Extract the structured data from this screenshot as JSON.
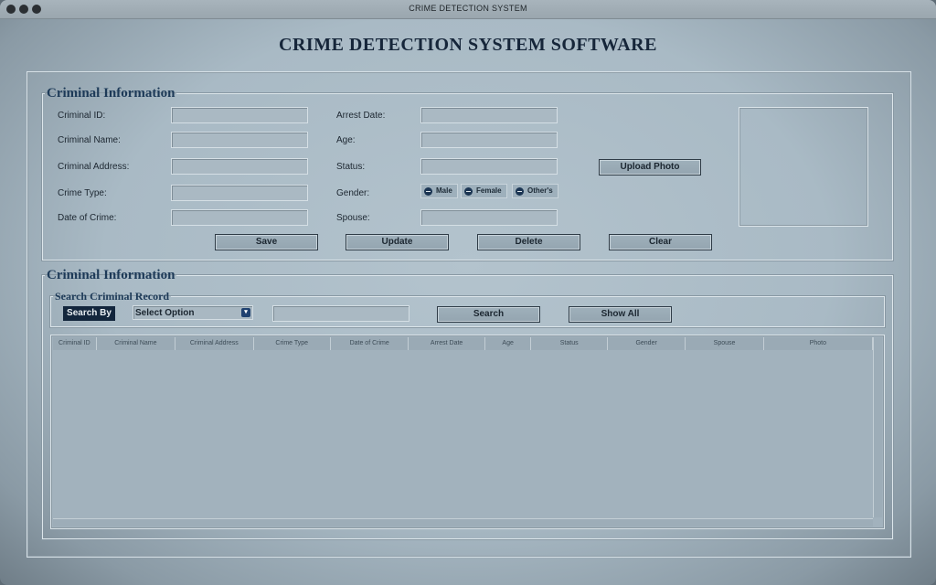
{
  "window": {
    "title": "CRIME DETECTION SYSTEM"
  },
  "app": {
    "title": "CRIME DETECTION SYSTEM SOFTWARE"
  },
  "info_section": {
    "legend": "Criminal Information",
    "left_fields": [
      {
        "label": "Criminal ID:",
        "value": ""
      },
      {
        "label": "Criminal Name:",
        "value": ""
      },
      {
        "label": "Criminal Address:",
        "value": ""
      },
      {
        "label": "Crime Type:",
        "value": ""
      },
      {
        "label": "Date of Crime:",
        "value": ""
      }
    ],
    "right_fields": [
      {
        "label": "Arrest Date:",
        "value": ""
      },
      {
        "label": "Age:",
        "value": ""
      },
      {
        "label": "Status:",
        "value": ""
      },
      {
        "label": "Gender:"
      },
      {
        "label": "Spouse:",
        "value": ""
      }
    ],
    "gender_options": [
      "Male",
      "Female",
      "Other's"
    ],
    "upload_photo_label": "Upload Photo",
    "buttons": {
      "save": "Save",
      "update": "Update",
      "delete": "Delete",
      "clear": "Clear"
    }
  },
  "records_section": {
    "legend": "Criminal Information",
    "search_legend": "Search Criminal Record",
    "search_by_label": "Search By",
    "select_value": "Select Option",
    "search_value": "",
    "search_button": "Search",
    "show_all_button": "Show All",
    "columns": [
      "Criminal ID",
      "Criminal Name",
      "Criminal Address",
      "Crime Type",
      "Date of Crime",
      "Arrest Date",
      "Age",
      "Status",
      "Gender",
      "Spouse",
      "Photo"
    ],
    "rows": []
  },
  "icons": {
    "select_arrow": "chevron-down-icon",
    "radio": "radio-icon"
  }
}
